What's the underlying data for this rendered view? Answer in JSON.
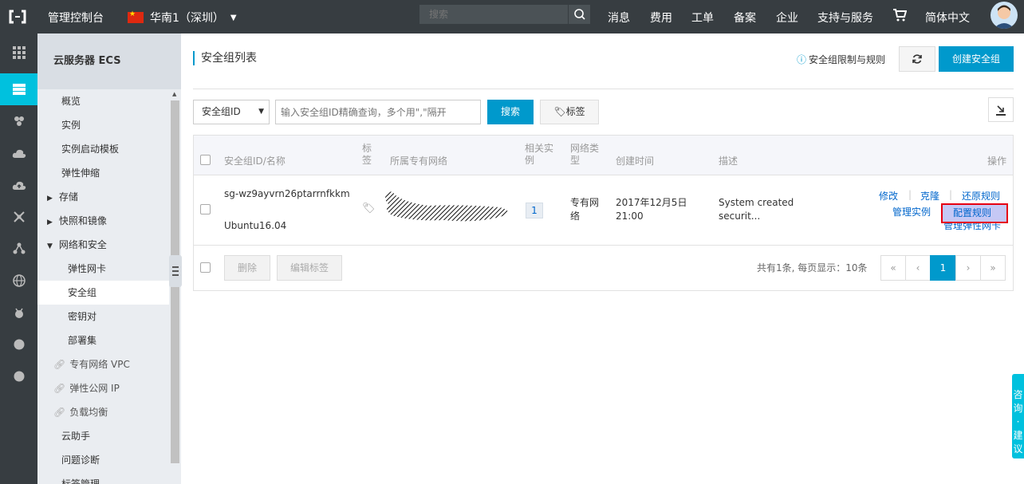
{
  "topbar": {
    "console_label": "管理控制台",
    "region_label": "华南1（深圳）",
    "search_placeholder": "搜索",
    "nav": [
      "消息",
      "费用",
      "工单",
      "备案",
      "企业",
      "支持与服务",
      "简体中文"
    ]
  },
  "sidebar": {
    "title": "云服务器 ECS",
    "items": [
      "概览",
      "实例",
      "实例启动模板",
      "弹性伸缩",
      "存储",
      "快照和镜像",
      "网络和安全",
      "弹性网卡",
      "安全组",
      "密钥对",
      "部署集",
      "专有网络 VPC",
      "弹性公网 IP",
      "负载均衡",
      "云助手",
      "问题诊断",
      "标签管理"
    ],
    "active": "安全组"
  },
  "main": {
    "page_title": "安全组列表",
    "help_link": "安全组限制与规则",
    "create_button": "创建安全组",
    "filter_select": "安全组ID",
    "search_placeholder": "输入安全组ID精确查询，多个用\",\"隔开",
    "search_button": "搜索",
    "tag_button": "标签",
    "columns": {
      "id_name": "安全组ID/名称",
      "tag": "标签",
      "vpc": "所属专有网络",
      "related_instances": "相关实例",
      "network_type": "网络类型",
      "created": "创建时间",
      "description": "描述",
      "actions": "操作"
    },
    "row": {
      "id": "sg-wz9ayvrn26ptarrnfkkm",
      "name": "Ubuntu16.04",
      "related_instances": "1",
      "network_type": "专有网络",
      "created": "2017年12月5日 21:00",
      "description": "System created securit..."
    },
    "actions": {
      "modify": "修改",
      "clone": "克隆",
      "restore": "还原规则",
      "manage_instances": "管理实例",
      "configure_rules": "配置规则",
      "manage_eni": "管理弹性网卡"
    },
    "bulk": {
      "delete": "删除",
      "edit_tags": "编辑标签"
    },
    "pagination": {
      "summary": "共有1条, 每页显示：10条",
      "first": "«",
      "prev": "‹",
      "current": "1",
      "next": "›",
      "last": "»"
    }
  },
  "float_widget": "咨询·建议",
  "colors": {
    "primary": "#0099cc",
    "accent": "#00c1de",
    "topbar": "#373d41",
    "highlight": "#e60012"
  }
}
